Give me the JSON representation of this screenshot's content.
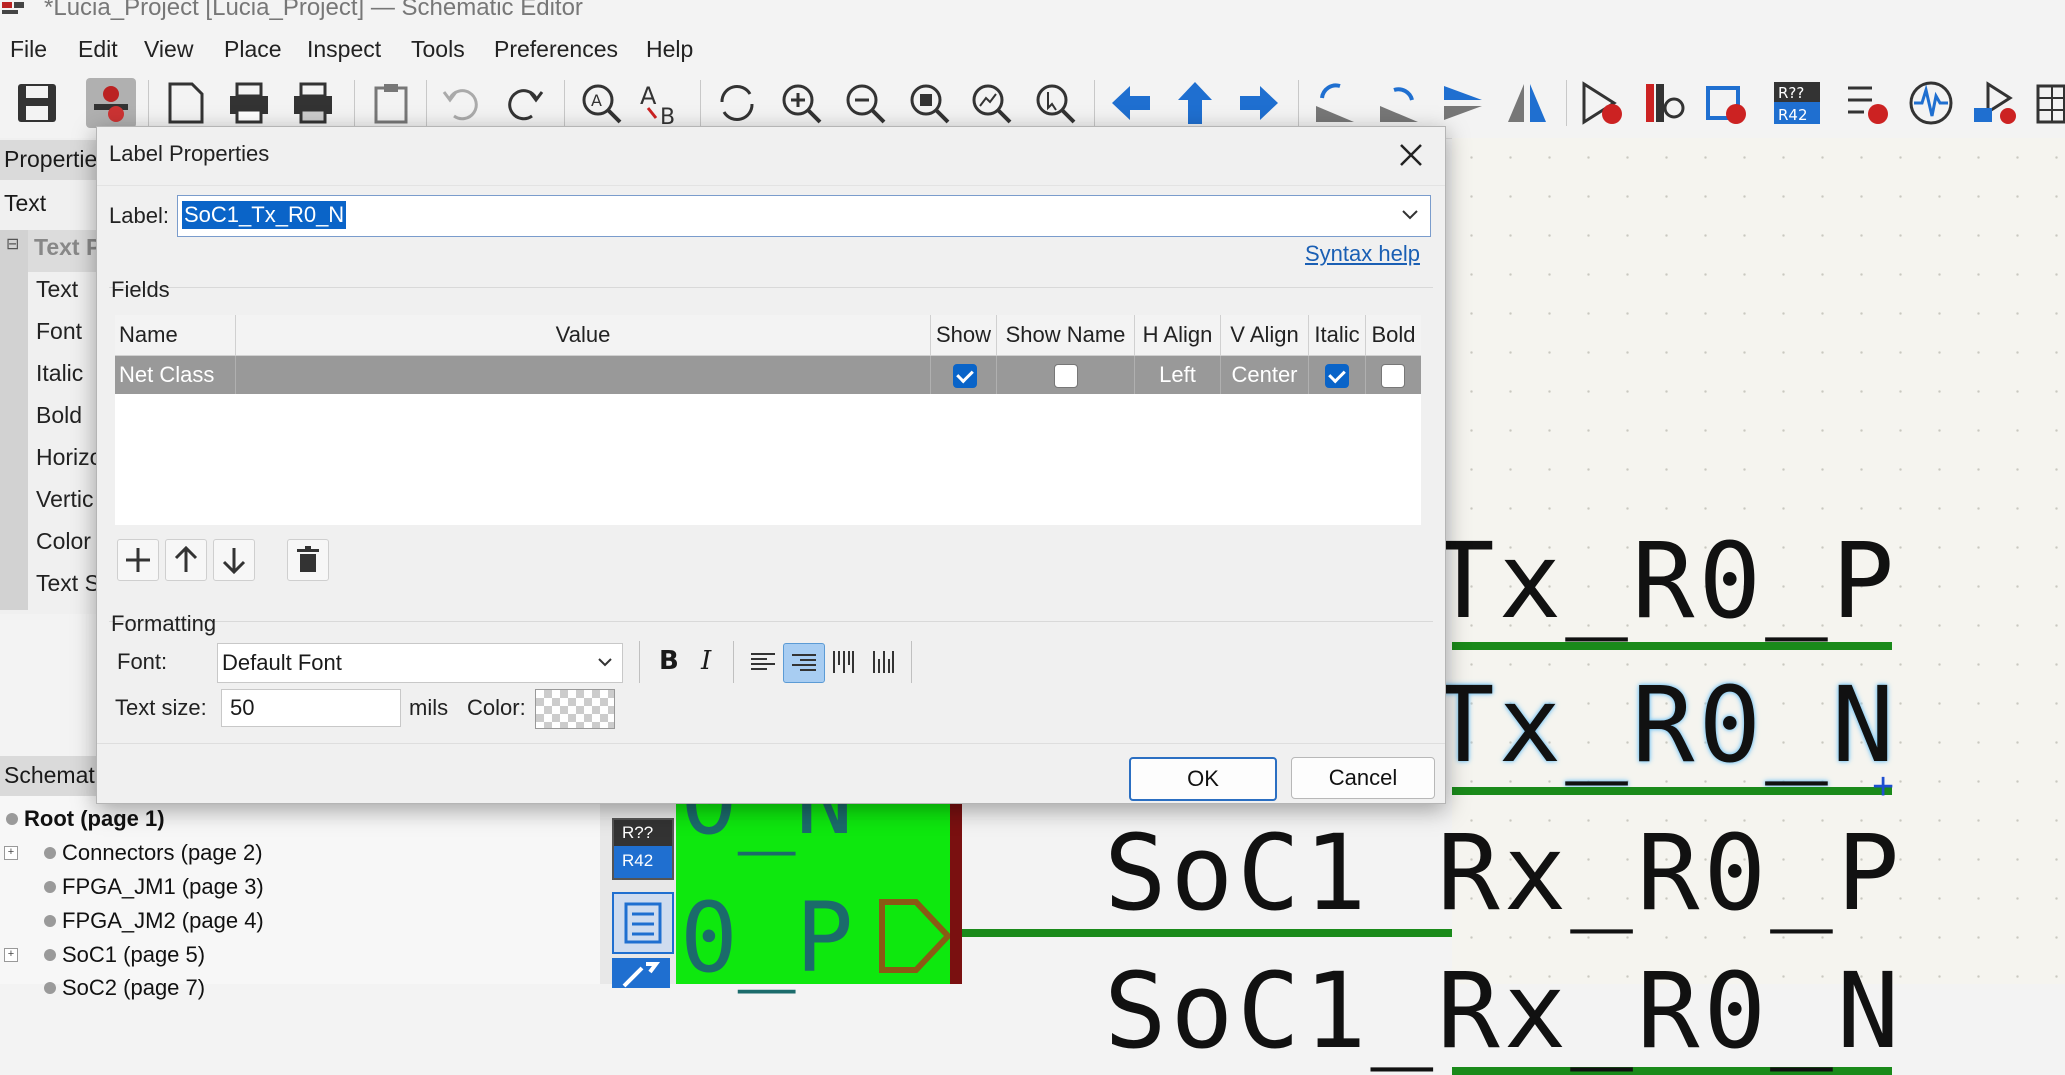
{
  "window": {
    "title": "*Lucia_Project [Lucia_Project] — Schematic Editor"
  },
  "menu": [
    "File",
    "Edit",
    "View",
    "Place",
    "Inspect",
    "Tools",
    "Preferences",
    "Help"
  ],
  "toolbar": {
    "icons": [
      "save-icon",
      "schematic-setup-icon",
      "page-settings-icon",
      "print-icon",
      "plot-icon",
      "paste-icon",
      "undo-icon",
      "redo-icon",
      "find-icon",
      "find-replace-icon",
      "refresh-icon",
      "zoom-in-icon",
      "zoom-out-icon",
      "zoom-fit-icon",
      "zoom-objects-icon",
      "zoom-selection-icon",
      "navigate-back-icon",
      "navigate-up-icon",
      "navigate-forward-icon",
      "rotate-ccw-icon",
      "rotate-cw-icon",
      "mirror-vertical-icon",
      "mirror-horizontal-icon",
      "symbol-editor-icon",
      "symbol-browser-icon",
      "footprint-assign-icon",
      "annotate-icon",
      "erc-icon",
      "simulator-icon",
      "pcb-editor-icon",
      "grid-icon"
    ]
  },
  "properties_panel": {
    "title": "Propertie",
    "type": "Text",
    "group": "Text P",
    "rows": [
      "Text",
      "Font",
      "Italic",
      "Bold",
      "Horizo",
      "Vertic",
      "Color",
      "Text S"
    ]
  },
  "hierarchy_panel": {
    "title": "Schemat",
    "items": [
      {
        "label": "Root (page 1)",
        "bold": true
      },
      {
        "label": "Connectors (page 2)",
        "expandable": true
      },
      {
        "label": "FPGA_JM1 (page 3)"
      },
      {
        "label": "FPGA_JM2 (page 4)"
      },
      {
        "label": "SoC1 (page 5)",
        "expandable": true
      },
      {
        "label": "SoC2 (page 7)"
      }
    ]
  },
  "canvas": {
    "net_labels": [
      "Tx_R0_P",
      "Tx_R0_N",
      "SoC1_Rx_R0_P",
      "SoC1_Rx_R0_N"
    ],
    "symbol_labels": [
      "0_N",
      "0_P"
    ],
    "side_tool_label_top": "R??",
    "side_tool_label_bottom": "R42"
  },
  "dialog": {
    "title": "Label Properties",
    "label_field": {
      "label": "Label:",
      "value": "SoC1_Tx_R0_N"
    },
    "syntax_help": "Syntax help",
    "fields_section": "Fields",
    "table": {
      "columns": [
        "Name",
        "Value",
        "Show",
        "Show Name",
        "H Align",
        "V Align",
        "Italic",
        "Bold"
      ],
      "rows": [
        {
          "name": "Net Class",
          "value": "",
          "show": true,
          "show_name": false,
          "h_align": "Left",
          "v_align": "Center",
          "italic": true,
          "bold": false
        }
      ]
    },
    "formatting_section": "Formatting",
    "font_label": "Font:",
    "font_value": "Default Font",
    "text_size_label": "Text size:",
    "text_size_value": "50",
    "text_size_unit": "mils",
    "color_label": "Color:",
    "ok_label": "OK",
    "cancel_label": "Cancel"
  },
  "colors": {
    "wire": "#1a8a1a",
    "symbol_fill": "#0ee80e",
    "accent": "#0a64c8"
  }
}
